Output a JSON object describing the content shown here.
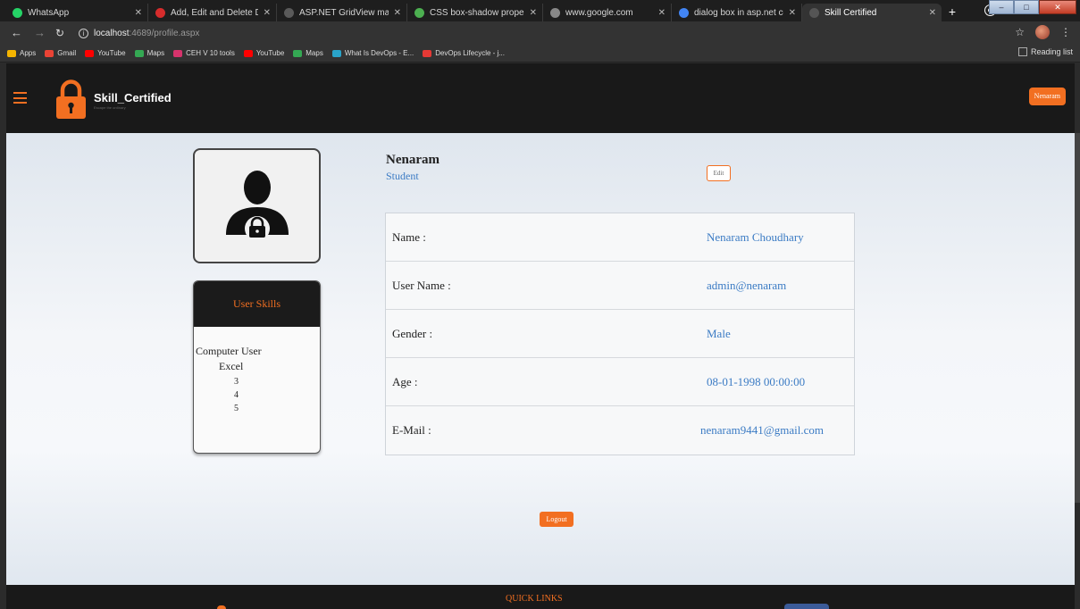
{
  "browser": {
    "tabs": [
      {
        "title": "WhatsApp",
        "color": "#25d366",
        "active": false
      },
      {
        "title": "Add, Edit and Delete Data",
        "color": "#d62c2c",
        "active": false
      },
      {
        "title": "ASP.NET GridView makeo",
        "color": "#5a5a5a",
        "active": false
      },
      {
        "title": "CSS box-shadow property",
        "color": "#4caf50",
        "active": false
      },
      {
        "title": "www.google.com",
        "color": "#888888",
        "active": false
      },
      {
        "title": "dialog box in asp.net c# -",
        "color": "#4285f4",
        "active": false
      },
      {
        "title": "Skill Certified",
        "color": "#555555",
        "active": true
      }
    ],
    "url_host": "localhost",
    "url_path": ":4689/profile.aspx",
    "bookmarks": [
      {
        "label": "Apps",
        "color": "#f4b400"
      },
      {
        "label": "Gmail",
        "color": "#ea4335"
      },
      {
        "label": "YouTube",
        "color": "#ff0000"
      },
      {
        "label": "Maps",
        "color": "#34a853"
      },
      {
        "label": "CEH V 10 tools",
        "color": "#d6336c"
      },
      {
        "label": "YouTube",
        "color": "#ff0000"
      },
      {
        "label": "Maps",
        "color": "#34a853"
      },
      {
        "label": "What Is DevOps - E...",
        "color": "#29a3c9"
      },
      {
        "label": "DevOps Lifecycle - j...",
        "color": "#e53935"
      }
    ],
    "reading_list": "Reading list"
  },
  "header": {
    "brand": "Skill_Certified",
    "tagline": "Escape the ordinary",
    "user_button": "Nenaram",
    "accent": "#f26f21"
  },
  "profile": {
    "name": "Nenaram",
    "role": "Student",
    "edit_label": "Edit",
    "fields": [
      {
        "label": "Name :",
        "value": "Nenaram Choudhary"
      },
      {
        "label": "User Name :",
        "value": "admin@nenaram"
      },
      {
        "label": "Gender :",
        "value": "Male"
      },
      {
        "label": "Age :",
        "value": "08-01-1998 00:00:00"
      },
      {
        "label": "E-Mail :",
        "value": "nenaram9441@gmail.com"
      }
    ],
    "logout_label": "Logout"
  },
  "skills": {
    "title": "User Skills",
    "category": "Computer User",
    "item": "Excel",
    "levels": [
      "3",
      "4",
      "5"
    ]
  },
  "footer": {
    "quick_links": "QUICK LINKS"
  }
}
